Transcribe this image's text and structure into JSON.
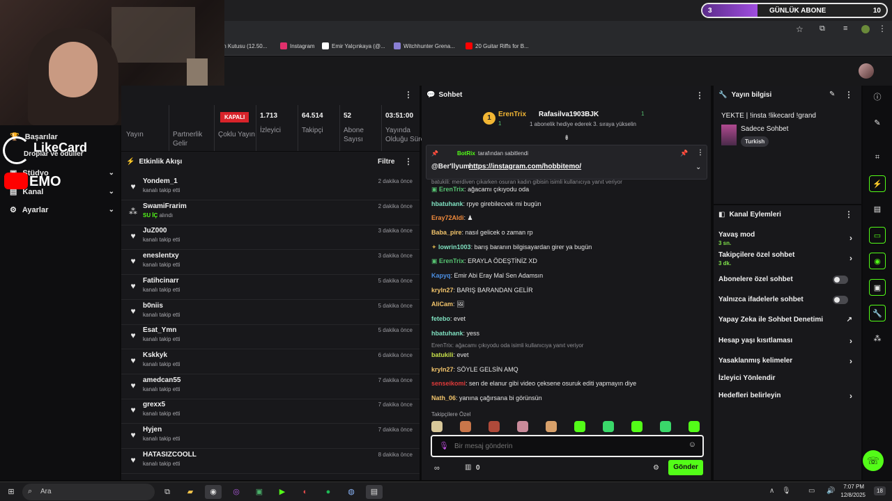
{
  "browser": {
    "bookmarks": [
      {
        "label": "len Kutusu (12.50...",
        "color": "#4a90e2"
      },
      {
        "label": "Instagram",
        "color": "#e1306c"
      },
      {
        "label": "Emir Yalçınkaya (@...",
        "color": "#ffffff"
      },
      {
        "label": "Witchhunter Grena...",
        "color": "#8a7fd4"
      },
      {
        "label": "20 Guitar Riffs for B...",
        "color": "#ff0000"
      }
    ]
  },
  "sub_goal": {
    "current": "3",
    "label": "GÜNLÜK ABONE",
    "target": "10",
    "progress": 0.3
  },
  "overlay": {
    "brand": "LikeCard",
    "name": "EMO"
  },
  "left_nav": {
    "items": [
      {
        "label": "Başarılar"
      },
      {
        "label": "Droplar ve ödüller"
      },
      {
        "label": "Stüdyo"
      },
      {
        "label": "Kanal"
      },
      {
        "label": "Ayarlar"
      }
    ]
  },
  "stats": {
    "status": "KAPALI",
    "columns": [
      {
        "label": "Yayın",
        "value": ""
      },
      {
        "label": "Partnerlik Gelir",
        "value": ""
      },
      {
        "label": "Çoklu Yayın",
        "value": ""
      },
      {
        "label": "İzleyici",
        "value": "1.713"
      },
      {
        "label": "Takipçi",
        "value": "64.514"
      },
      {
        "label": "Abone Sayısı",
        "value": "52"
      },
      {
        "label": "Yayında Olduğu Süre",
        "value": "03:51:00"
      }
    ]
  },
  "activity": {
    "title": "Etkinlik Akışı",
    "filter": "Filtre",
    "items": [
      {
        "name": "Yondem_1",
        "sub": "kanalı takip etti",
        "time": "2 dakika önce",
        "icon": "heart-icon"
      },
      {
        "name": "SwamiFrarim",
        "sub_highlight": "SU İÇ",
        "sub": "alındı",
        "time": "2 dakika önce",
        "icon": "points-icon"
      },
      {
        "name": "JuZ000",
        "sub": "kanalı takip etti",
        "time": "3 dakika önce",
        "icon": "heart-icon"
      },
      {
        "name": "eneslentxy",
        "sub": "kanalı takip etti",
        "time": "3 dakika önce",
        "icon": "heart-icon"
      },
      {
        "name": "Fatihcinarr",
        "sub": "kanalı takip etti",
        "time": "5 dakika önce",
        "icon": "heart-icon"
      },
      {
        "name": "b0niis",
        "sub": "kanalı takip etti",
        "time": "5 dakika önce",
        "icon": "heart-icon"
      },
      {
        "name": "Esat_Ymn",
        "sub": "kanalı takip etti",
        "time": "5 dakika önce",
        "icon": "heart-icon"
      },
      {
        "name": "Kskkyk",
        "sub": "kanalı takip etti",
        "time": "6 dakika önce",
        "icon": "heart-icon"
      },
      {
        "name": "amedcan55",
        "sub": "kanalı takip etti",
        "time": "7 dakika önce",
        "icon": "heart-icon"
      },
      {
        "name": "grexx5",
        "sub": "kanalı takip etti",
        "time": "7 dakika önce",
        "icon": "heart-icon"
      },
      {
        "name": "Hyjen",
        "sub": "kanalı takip etti",
        "time": "7 dakika önce",
        "icon": "heart-icon"
      },
      {
        "name": "HATASIZCOOLL",
        "sub": "kanalı takip etti",
        "time": "8 dakika önce",
        "icon": "heart-icon"
      }
    ]
  },
  "chat": {
    "title": "Sohbet",
    "gift": {
      "gifter": "ErenTrix",
      "gifter_count": "1",
      "rank": "1",
      "recipient": "Rafasilva1903BJK",
      "recipient_count": "1",
      "text": "1 abonelik hediye ederek 3. sıraya yükselin"
    },
    "pinned": {
      "bot": "BotRix",
      "by": "tarafından sabitlendi",
      "text_prefix": "@Ber'llyum",
      "link": "https://instagram.com/hobbitemo/"
    },
    "top_reply": "batukili: merdiven çıkarken osuran kadın gibisin isimli kullanıcıya yanıt veriyor",
    "messages": [
      {
        "user": "ErenTrix",
        "color": "#56c271",
        "text": "ağacamı çıkıyodu oda",
        "badge": "sub"
      },
      {
        "user": "hbatuhank",
        "color": "#7fe0c0",
        "text": "rpye girebilecvek mi bugün"
      },
      {
        "user": "Eray72Aldi",
        "color": "#f08a3c",
        "text": "♟"
      },
      {
        "user": "Baba_pire",
        "color": "#f2c46b",
        "text": "nasıl gelicek o zaman rp"
      },
      {
        "user": "lowrin1003",
        "color": "#7fe0c0",
        "text": "barış baranın bilgisayardan girer ya bugün",
        "badge": "wheat"
      },
      {
        "user": "ErenTrix",
        "color": "#56c271",
        "text": "ERAYLA ÖDEŞTİNİZ XD",
        "badge": "sub"
      },
      {
        "user": "Kapyq",
        "color": "#4a8de0",
        "text": "Emir Abi Eray Mal Sen Adamsın"
      },
      {
        "user": "kryln27",
        "color": "#f2c46b",
        "text": "BARIŞ BARANDAN GELİR"
      },
      {
        "user": "AliCam",
        "color": "#f2c46b",
        "text": "🖼"
      },
      {
        "user": "fetebo",
        "color": "#7fe0c0",
        "text": "evet"
      },
      {
        "user": "hbatuhank",
        "color": "#7fe0c0",
        "text": "yess"
      },
      {
        "user": "batukili",
        "color": "#c7e04a",
        "text": "evet",
        "reply": "ErenTrix: ağacamı çıkıyodu oda isimli kullanıcıya yanıt veriyor"
      },
      {
        "user": "kryln27",
        "color": "#f2c46b",
        "text": "SÖYLE GELSİN AMQ"
      },
      {
        "user": "senseikomi",
        "color": "#e03a3a",
        "text": "sen de elanur gibi video çeksene osuruk editi yapmayın diye"
      },
      {
        "user": "Nath_06",
        "color": "#f2c46b",
        "text": "yanına çağırsana bi görünsün"
      }
    ],
    "emote_section": "Takipçilere Özel",
    "input_placeholder": "Bir mesaj gönderin",
    "points": "0",
    "send": "Gönder"
  },
  "stream_info": {
    "title": "Yayın bilgisi",
    "stream_title": "YEKTE | !insta !likecard !grand",
    "category": "Sadece Sohbet",
    "tag": "Turkish"
  },
  "channel_actions": {
    "title": "Kanal Eylemleri",
    "items": [
      {
        "label": "Yavaş mod",
        "sub": "3 sn.",
        "control": "arrow"
      },
      {
        "label": "Takipçilere özel sohbet",
        "sub": "3 dk.",
        "control": "arrow"
      },
      {
        "label": "Abonelere özel sohbet",
        "control": "toggle"
      },
      {
        "label": "Yalnızca ifadelerle sohbet",
        "control": "toggle"
      },
      {
        "label": "Yapay Zeka ile Sohbet Denetimi",
        "control": "external"
      },
      {
        "label": "Hesap yaşı kısıtlaması",
        "control": "arrow"
      },
      {
        "label": "Yasaklanmış kelimeler",
        "control": "arrow"
      },
      {
        "label": "İzleyici Yönlendir",
        "control": "none"
      },
      {
        "label": "Hedefleri belirleyin",
        "control": "arrow"
      }
    ]
  },
  "taskbar": {
    "search": "Ara",
    "time": "7:07 PM",
    "date": "12/8/2025",
    "notif": "18"
  },
  "colors": {
    "accent": "#53fc18",
    "bg": "#0b0b0c",
    "panel": "#18181b"
  }
}
